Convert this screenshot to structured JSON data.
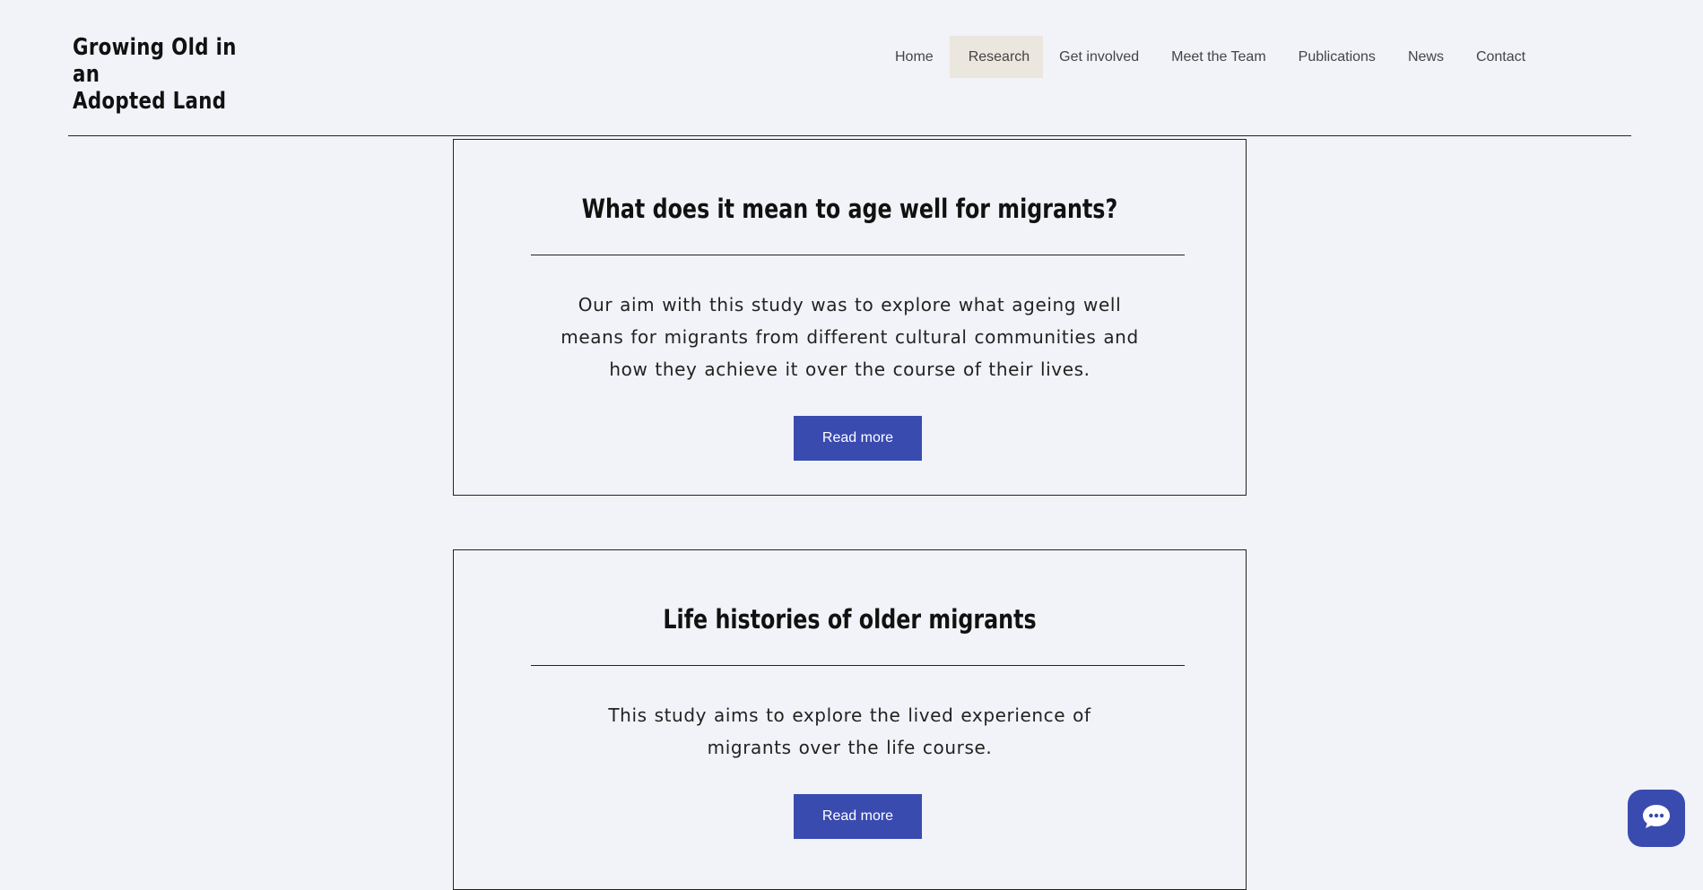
{
  "site": {
    "title_line1": "Growing Old in an",
    "title_line2": "Adopted Land"
  },
  "nav": {
    "items": [
      {
        "label": "Home",
        "active": false
      },
      {
        "label": "Research",
        "active": true
      },
      {
        "label": "Get involved",
        "active": false
      },
      {
        "label": "Meet the Team",
        "active": false
      },
      {
        "label": "Publications",
        "active": false
      },
      {
        "label": "News",
        "active": false
      },
      {
        "label": "Contact",
        "active": false
      }
    ]
  },
  "studies": [
    {
      "title": "What does it mean to age well for migrants?",
      "description": "Our aim with this study was to explore what ageing well means for migrants from different cultural communities and how they achieve it over the course of their lives.",
      "button_label": "Read more"
    },
    {
      "title": "Life histories of older migrants",
      "description": "This study aims to explore the lived experience of migrants over the life course.",
      "button_label": "Read more"
    }
  ],
  "chat": {
    "icon": "chat-bubble-icon"
  },
  "colors": {
    "background": "#f1f3f8",
    "accent": "#3a4bb0",
    "active_nav_bg": "#ebe6de",
    "text": "#111111"
  }
}
